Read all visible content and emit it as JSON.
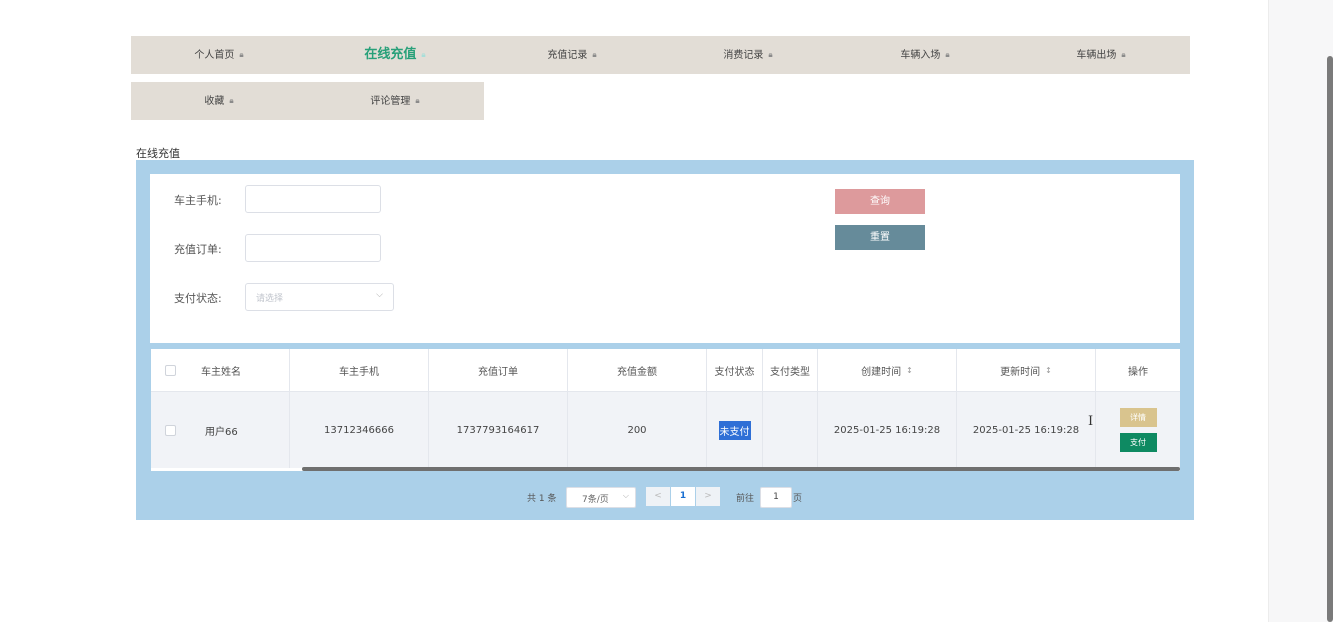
{
  "nav": {
    "row1": [
      {
        "label": "个人首页",
        "icon": "lock-icon"
      },
      {
        "label": "在线充值",
        "icon": "lock-icon",
        "active": true
      },
      {
        "label": "充值记录",
        "icon": "lock-icon"
      },
      {
        "label": "消费记录",
        "icon": "lock-icon"
      },
      {
        "label": "车辆入场",
        "icon": "lock-icon"
      },
      {
        "label": "车辆出场",
        "icon": "lock-icon"
      }
    ],
    "row2": [
      {
        "label": "收藏",
        "icon": "lock-icon"
      },
      {
        "label": "评论管理",
        "icon": "lock-icon"
      }
    ]
  },
  "page": {
    "title": "在线充值"
  },
  "search": {
    "phone_label": "车主手机:",
    "phone_value": "",
    "order_label": "充值订单:",
    "order_value": "",
    "status_label": "支付状态:",
    "status_placeholder": "请选择",
    "search_button": "查询",
    "reset_button": "重置"
  },
  "table": {
    "columns": [
      "车主姓名",
      "车主手机",
      "充值订单",
      "充值金额",
      "支付状态",
      "支付类型",
      "创建时间",
      "更新时间",
      "操作"
    ],
    "rows": [
      {
        "name": "用户66",
        "phone": "13712346666",
        "order": "1737793164617",
        "amount": "200",
        "status": "未支付",
        "pay_type": "",
        "created": "2025-01-25 16:19:28",
        "updated": "2025-01-25 16:19:28",
        "detail_button": "详情",
        "pay_button": "支付"
      }
    ]
  },
  "pagination": {
    "total": "共 1 条",
    "page_size": "7条/页",
    "current_page": "1",
    "goto_label": "前往",
    "goto_value": "1",
    "page_unit": "页"
  },
  "colors": {
    "nav_bg": "#e2ddd6",
    "active_nav": "#27a079",
    "panel_bg": "#abd0e9",
    "search_button": "#dd9a9c",
    "reset_button": "#668b9a",
    "detail_button": "#d9c48e",
    "pay_button": "#0e8a62",
    "status_highlight": "#2f6fd6"
  }
}
